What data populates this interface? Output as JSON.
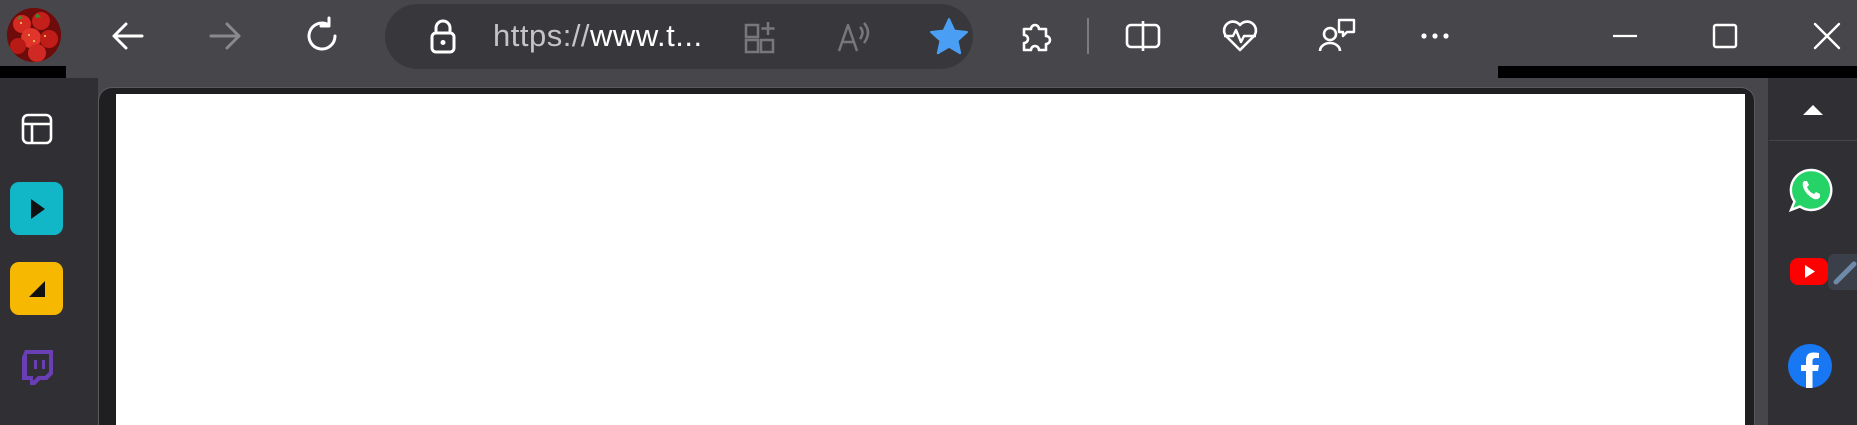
{
  "browser": {
    "address_bar": {
      "url_scheme": "https://",
      "url_rest": "www.t..."
    }
  },
  "toolbar": {
    "profile": "avatar",
    "back": "arrow-left-icon",
    "forward": "arrow-right-icon",
    "refresh": "refresh-icon",
    "lock": "lock-icon",
    "apps": "add-app-icon",
    "read_aloud": "read-aloud-icon",
    "favorite": "star-icon",
    "extensions": "puzzle-icon",
    "split_screen": "split-screen-icon",
    "health": "heartbeat-icon",
    "copilot": "chat-people-icon",
    "more": "more-icon"
  },
  "window_controls": [
    "minimize-icon",
    "maximize-icon",
    "close-icon"
  ],
  "left_sidebar": {
    "items": [
      {
        "icon": "tab-layout-icon"
      },
      {
        "icon": "play-app-icon",
        "color": "#12b7c7"
      },
      {
        "icon": "slice-app-icon",
        "color": "#f6b800"
      },
      {
        "icon": "twitch-icon",
        "color": "#6a3fb5"
      }
    ]
  },
  "right_sidebar": {
    "items": [
      {
        "icon": "chevron-up-icon"
      },
      {
        "icon": "whatsapp-icon",
        "color": "#25d366"
      },
      {
        "icon": "youtube-icon",
        "color": "#ff0000"
      },
      {
        "icon": "facebook-icon",
        "color": "#1877f2"
      }
    ]
  },
  "colors": {
    "toolbar_bg": "#47474b",
    "address_bg": "#38383c",
    "star_accent": "#4a9ff5"
  }
}
